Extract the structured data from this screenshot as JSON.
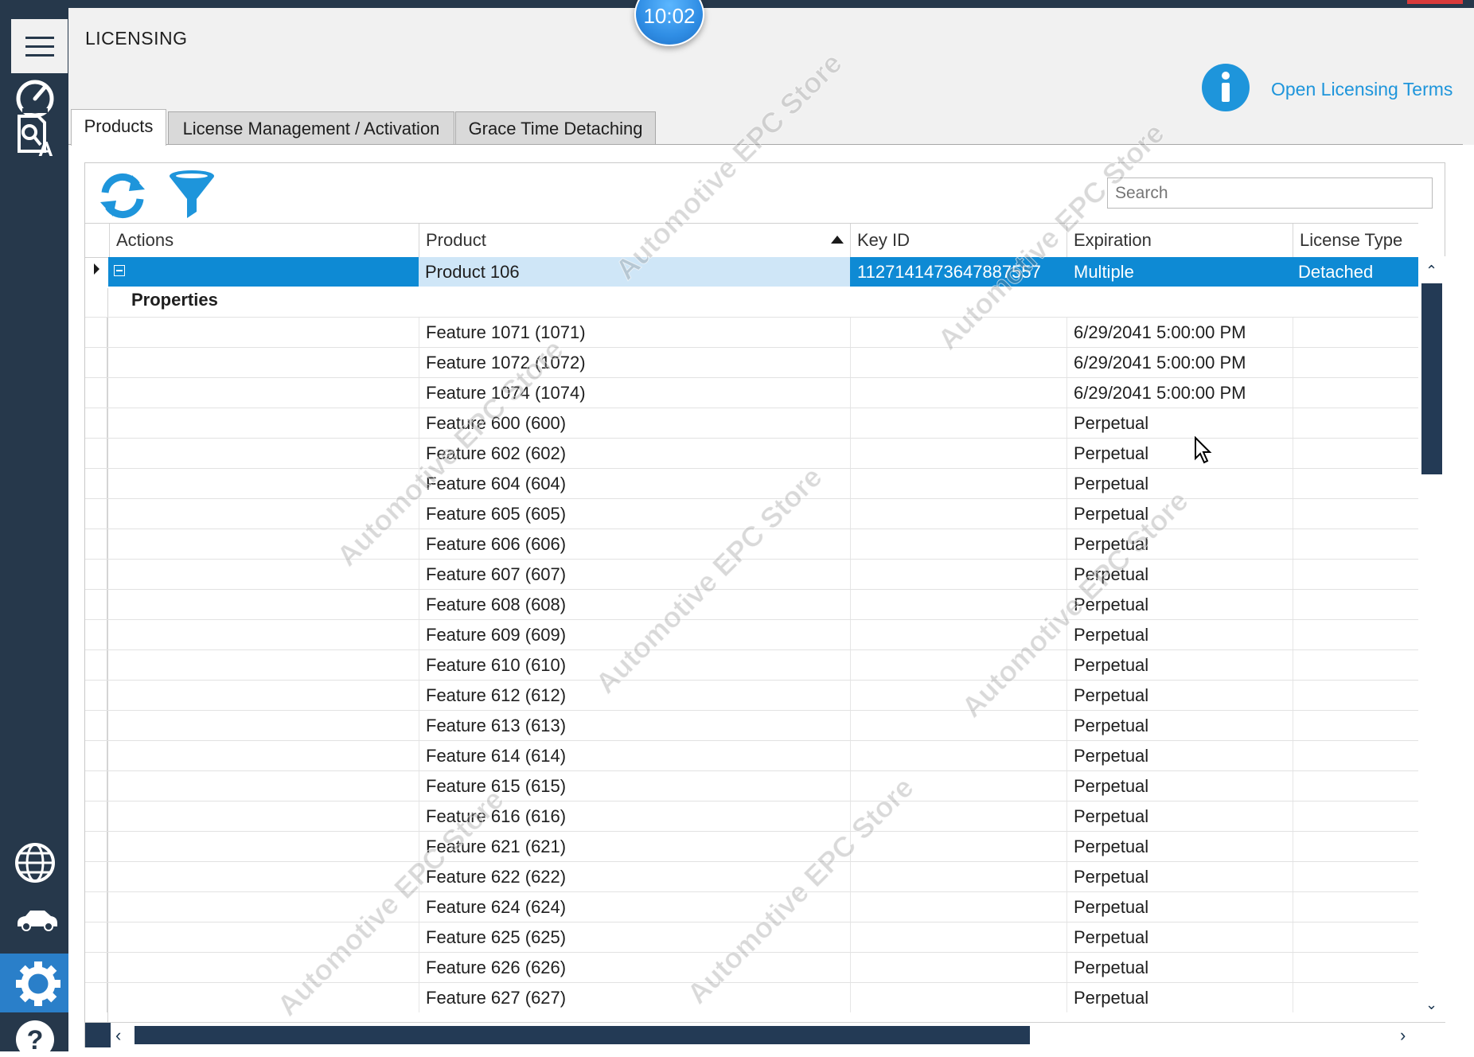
{
  "clock": "10:02",
  "header": {
    "title": "LICENSING",
    "info_link": "Open Licensing Terms"
  },
  "tabs": [
    {
      "label": "Products",
      "selected": true
    },
    {
      "label": "License Management / Activation",
      "selected": false
    },
    {
      "label": "Grace Time Detaching",
      "selected": false
    }
  ],
  "search": {
    "placeholder": "Search"
  },
  "nav": {
    "icons": [
      "menu-icon",
      "dashboard-gauge-icon",
      "search-translate-icon",
      "globe-icon",
      "car-icon",
      "settings-gear-icon",
      "help-icon"
    ],
    "active": "settings-gear-icon"
  },
  "table": {
    "columns": [
      "Actions",
      "Product",
      "Key ID",
      "Expiration",
      "License Type"
    ],
    "sorted_column": "Product",
    "sort_direction": "ascending",
    "selected_row": {
      "product": "Product 106",
      "key_id": "1127141473647887557",
      "expiration": "Multiple",
      "license_type": "Detached"
    },
    "group_label": "Properties",
    "features": [
      {
        "product": "Feature 1071 (1071)",
        "expiration": "6/29/2041 5:00:00 PM"
      },
      {
        "product": "Feature 1072 (1072)",
        "expiration": "6/29/2041 5:00:00 PM"
      },
      {
        "product": "Feature 1074 (1074)",
        "expiration": "6/29/2041 5:00:00 PM"
      },
      {
        "product": "Feature 600 (600)",
        "expiration": "Perpetual"
      },
      {
        "product": "Feature 602 (602)",
        "expiration": "Perpetual"
      },
      {
        "product": "Feature 604 (604)",
        "expiration": "Perpetual"
      },
      {
        "product": "Feature 605 (605)",
        "expiration": "Perpetual"
      },
      {
        "product": "Feature 606 (606)",
        "expiration": "Perpetual"
      },
      {
        "product": "Feature 607 (607)",
        "expiration": "Perpetual"
      },
      {
        "product": "Feature 608 (608)",
        "expiration": "Perpetual"
      },
      {
        "product": "Feature 609 (609)",
        "expiration": "Perpetual"
      },
      {
        "product": "Feature 610 (610)",
        "expiration": "Perpetual"
      },
      {
        "product": "Feature 612 (612)",
        "expiration": "Perpetual"
      },
      {
        "product": "Feature 613 (613)",
        "expiration": "Perpetual"
      },
      {
        "product": "Feature 614 (614)",
        "expiration": "Perpetual"
      },
      {
        "product": "Feature 615 (615)",
        "expiration": "Perpetual"
      },
      {
        "product": "Feature 616 (616)",
        "expiration": "Perpetual"
      },
      {
        "product": "Feature 621 (621)",
        "expiration": "Perpetual"
      },
      {
        "product": "Feature 622 (622)",
        "expiration": "Perpetual"
      },
      {
        "product": "Feature 624 (624)",
        "expiration": "Perpetual"
      },
      {
        "product": "Feature 625 (625)",
        "expiration": "Perpetual"
      },
      {
        "product": "Feature 626 (626)",
        "expiration": "Perpetual"
      },
      {
        "product": "Feature 627 (627)",
        "expiration": "Perpetual"
      }
    ]
  },
  "watermark": "Automotive EPC Store",
  "colors": {
    "accent": "#1e95db",
    "nav_bg": "#26384b",
    "selection": "#0e8ad4",
    "active_nav": "#2a7fc9"
  }
}
